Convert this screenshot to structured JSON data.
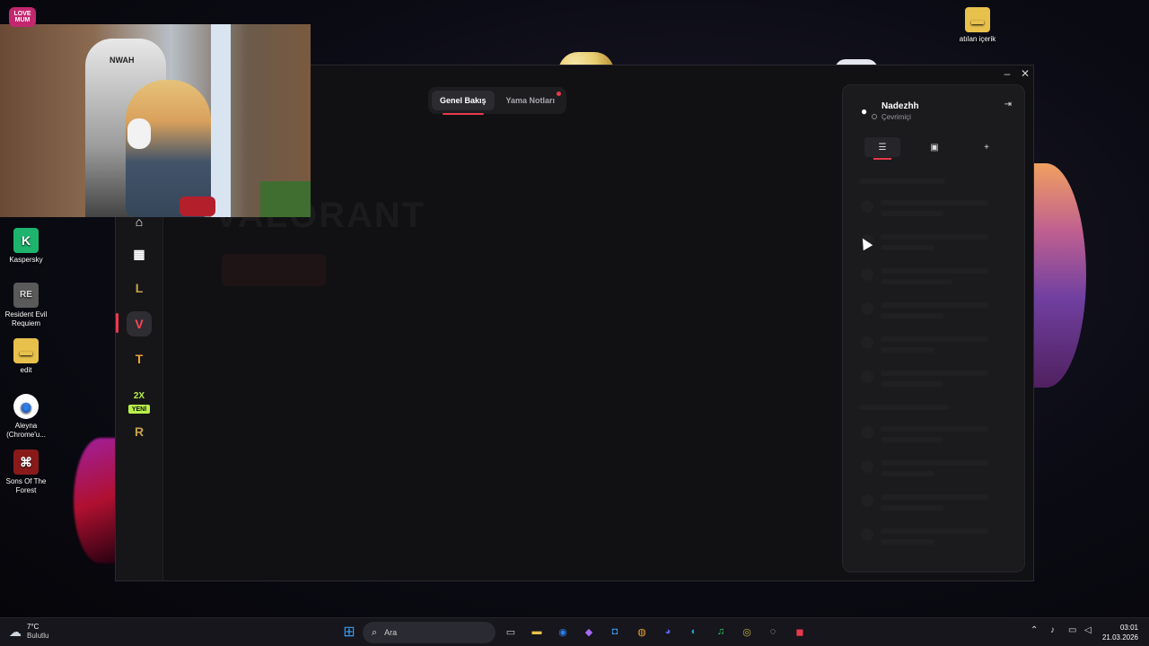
{
  "desktop": {
    "icons": [
      {
        "label": "Kaspersky",
        "glyph": "K",
        "color": "#1fb46e"
      },
      {
        "label": "Resident Evil Requiem",
        "glyph": "RE",
        "color": "#5a5a5a"
      },
      {
        "label": "edit",
        "glyph": "▬",
        "color": "#e8c04c"
      },
      {
        "label": "Aleyna (Chrome'u...",
        "glyph": "◉",
        "color": "#2b7de9"
      },
      {
        "label": "Sons Of The Forest",
        "glyph": "⌘",
        "color": "#8a1a1a"
      },
      {
        "label": "atılan içerik",
        "glyph": "▬",
        "color": "#e8c04c"
      }
    ]
  },
  "webcam": {
    "stream_logo": "LOVE MUM",
    "chair_text": "NWAH"
  },
  "client": {
    "tabs": [
      {
        "label": "Genel Bakış",
        "active": true
      },
      {
        "label": "Yama Notları",
        "active": false,
        "notification": true
      }
    ],
    "ghost_title": "VALORANT",
    "sidebar": [
      {
        "name": "home",
        "glyph": "⌂",
        "color": "#ffffff"
      },
      {
        "name": "library",
        "glyph": "▦",
        "color": "#ffffff"
      },
      {
        "name": "league-of-legends",
        "glyph": "L",
        "color": "#c8a24a"
      },
      {
        "name": "valorant",
        "glyph": "V",
        "color": "#ff4655"
      },
      {
        "name": "teamfight-tactics",
        "glyph": "T",
        "color": "#e9a23b"
      },
      {
        "name": "2xko",
        "glyph": "2X",
        "color": "#b8f04a"
      },
      {
        "name": "runeterra",
        "glyph": "R",
        "color": "#c8a24a"
      }
    ],
    "new_badge": "YENİ",
    "accent": "#e8394d"
  },
  "friends_panel": {
    "user_name": "Nadezhh",
    "status": "Çevrimiçi",
    "tabs": [
      {
        "name": "friends-list",
        "glyph": "☰",
        "active": true
      },
      {
        "name": "messages",
        "glyph": "▣",
        "active": false
      },
      {
        "name": "add-friend",
        "glyph": "+",
        "active": false
      }
    ]
  },
  "taskbar": {
    "weather_temp": "7°C",
    "weather_desc": "Bulutlu",
    "search_placeholder": "Ara",
    "time": "03:01",
    "date": "21.03.2026",
    "apps": [
      {
        "name": "start",
        "glyph": "⊞",
        "color": "#3a9bf0"
      },
      {
        "name": "task-view",
        "glyph": "▭",
        "color": "#cfcfcf"
      },
      {
        "name": "file-explorer",
        "glyph": "▬",
        "color": "#e8c04c"
      },
      {
        "name": "chrome",
        "glyph": "◉",
        "color": "#2b7de9"
      },
      {
        "name": "copilot",
        "glyph": "◆",
        "color": "#a86af0"
      },
      {
        "name": "store",
        "glyph": "◘",
        "color": "#3a9bf0"
      },
      {
        "name": "app-orange",
        "glyph": "◍",
        "color": "#e8a030"
      },
      {
        "name": "discord",
        "glyph": "◕",
        "color": "#5865f2"
      },
      {
        "name": "edge",
        "glyph": "◐",
        "color": "#1ea4c8"
      },
      {
        "name": "spotify",
        "glyph": "♫",
        "color": "#1ed760"
      },
      {
        "name": "app-gold",
        "glyph": "◎",
        "color": "#c8b040"
      },
      {
        "name": "obs",
        "glyph": "◌",
        "color": "#cfcfcf"
      },
      {
        "name": "riot-client",
        "glyph": "◼",
        "color": "#e8394d"
      }
    ]
  }
}
